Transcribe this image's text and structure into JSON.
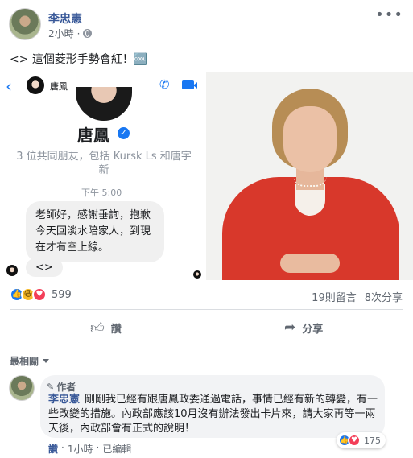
{
  "post": {
    "author": "李忠憲",
    "time": "2小時",
    "text": "<> 這個菱形手勢會紅！🆒"
  },
  "screenshot": {
    "small_name": "唐鳳",
    "big_name": "唐鳳",
    "mutual": "3 位共同朋友，包括 Kursk Ls 和唐宇新",
    "time": "下午 5:00",
    "message": "老師好，感謝垂詢，抱歉今天回淡水陪家人，到現在才有空上線。",
    "reply": "<>"
  },
  "stats": {
    "reaction_count": "599",
    "comments": "19則留言",
    "shares": "8次分享"
  },
  "actions": {
    "like": "讚",
    "share": "分享"
  },
  "comments_section": {
    "sort_label": "最相關",
    "comment": {
      "badge": "作者",
      "name": "李忠憲",
      "text": "剛剛我已經有跟唐鳳政委通過電話，事情已經有新的轉變，有一些改變的措施。內政部應該10月沒有辦法發出卡片來，請大家再等一兩天後，內政部會有正式的說明！",
      "reaction_count": "175",
      "like_link": "讚",
      "age": "1小時",
      "edited": "已編輯",
      "separator": "·"
    }
  },
  "colors": {
    "link_blue": "#385898",
    "accent_blue": "#1877f2",
    "jacket_red": "#d8382b"
  }
}
